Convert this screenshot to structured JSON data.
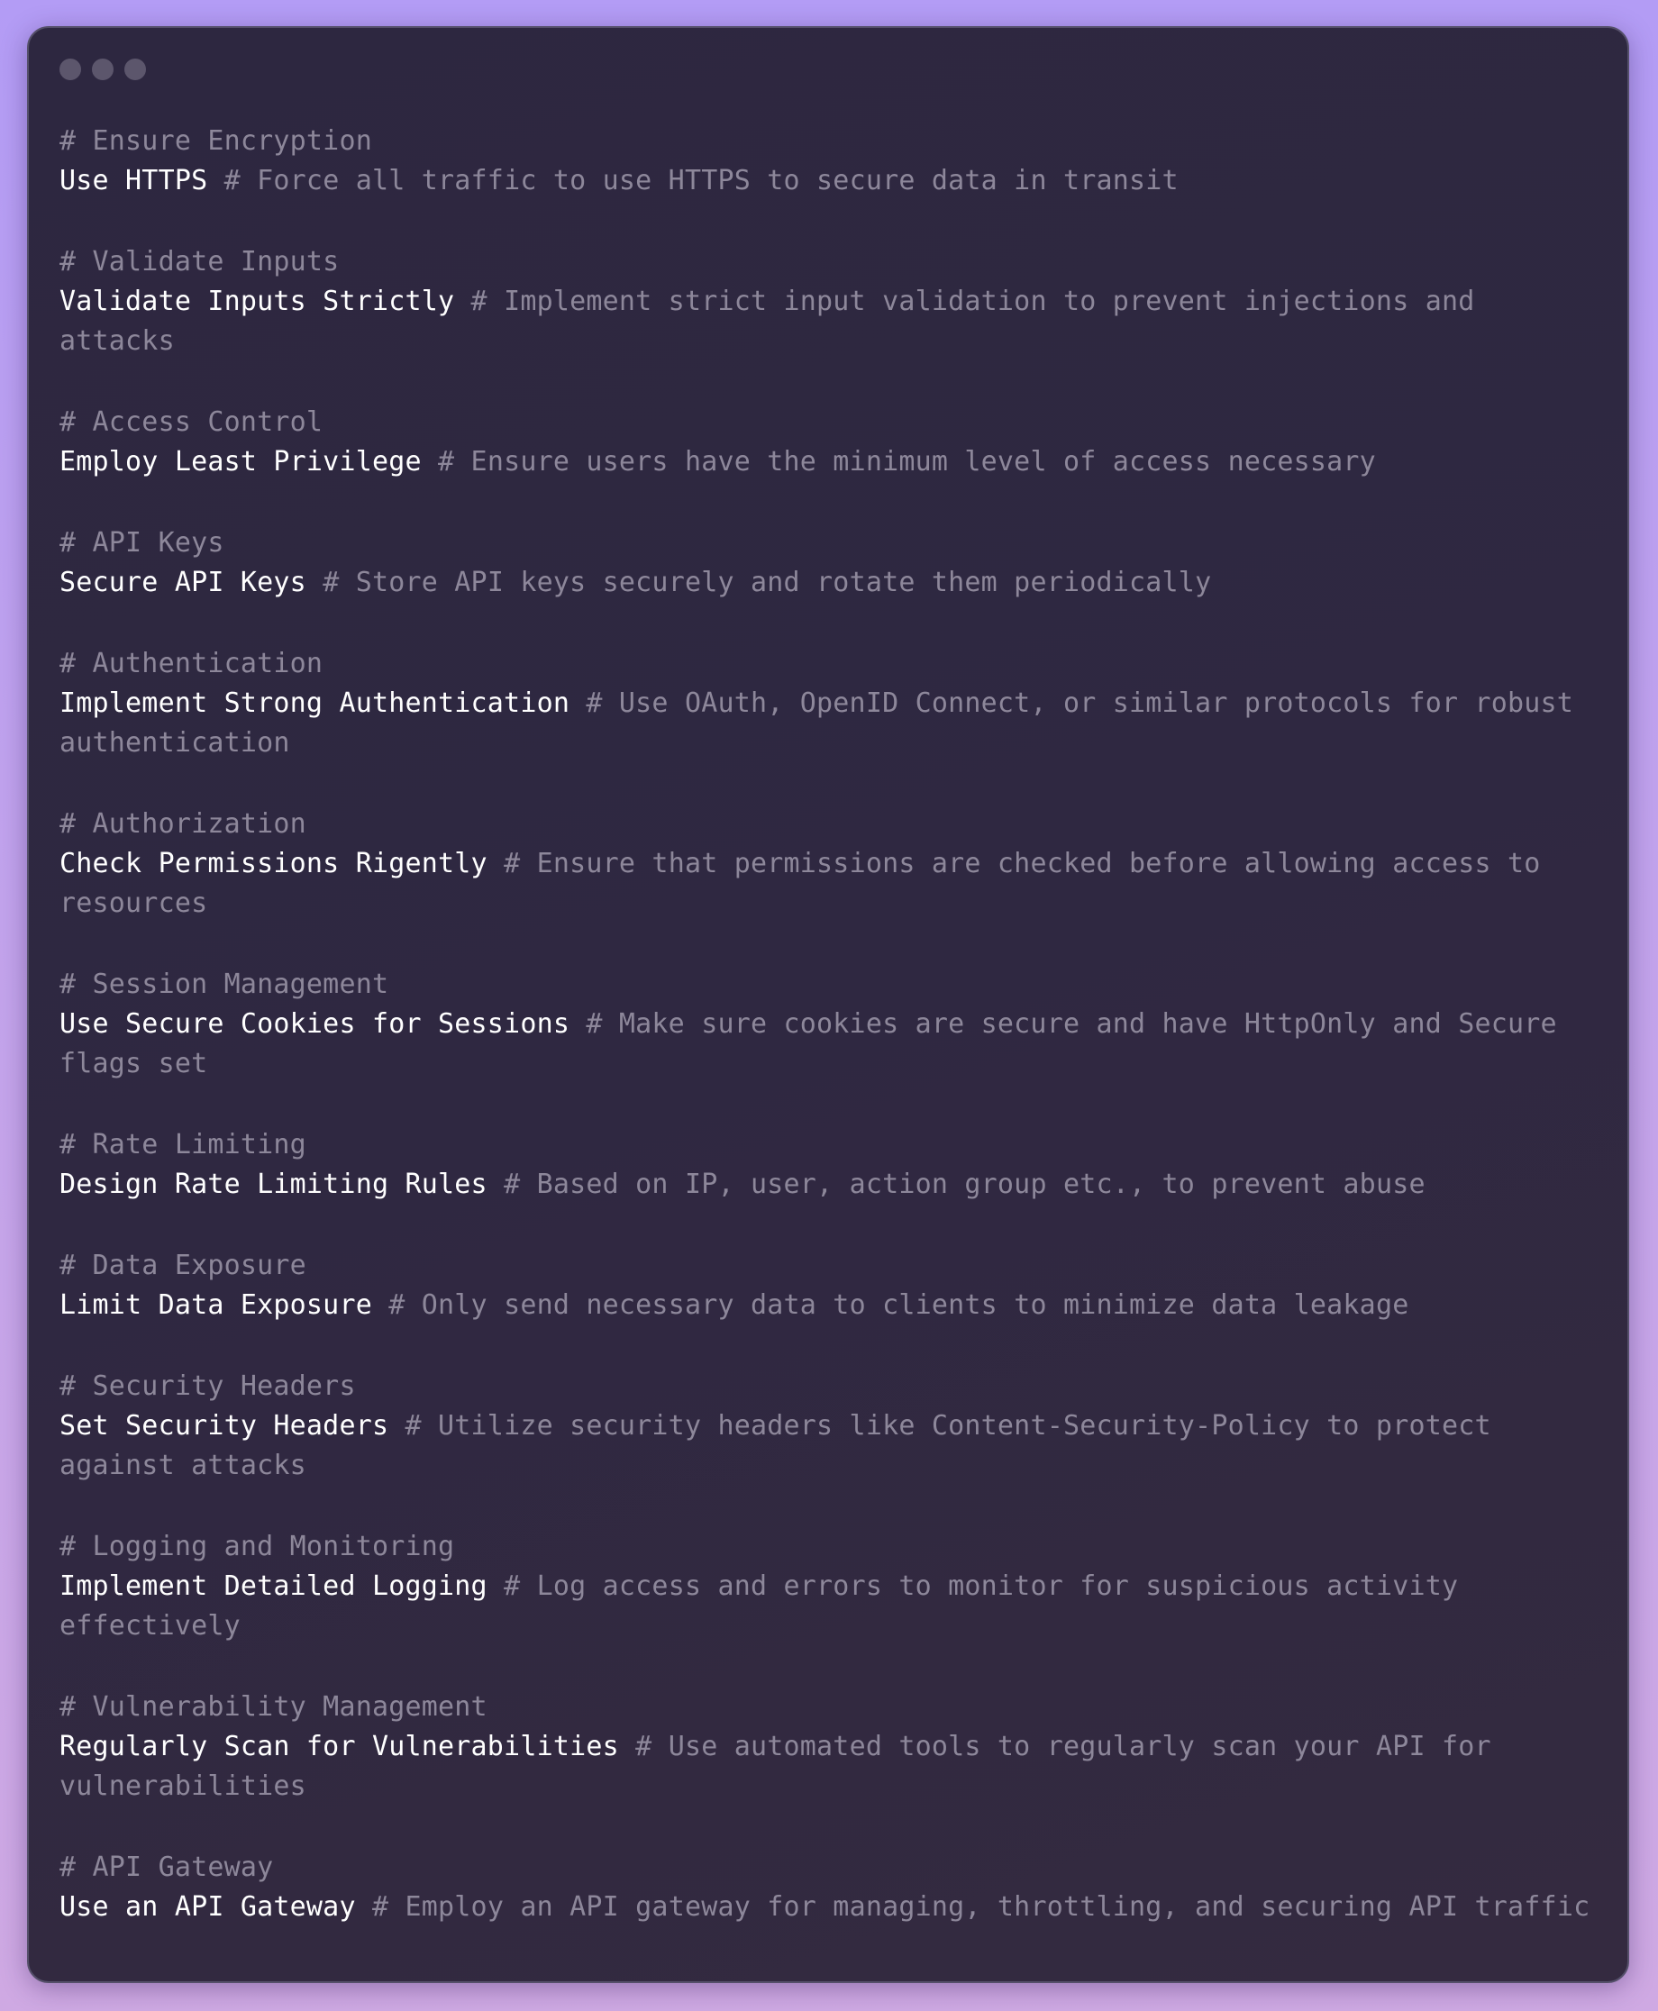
{
  "window": {
    "dot_colors": [
      "#5c566c",
      "#5c566c",
      "#5c566c"
    ]
  },
  "colors": {
    "background_top": "#b39cf5",
    "window_bg": "#2f2841",
    "command_text": "#ffffff",
    "comment_text": "#8d879a"
  },
  "blocks": [
    {
      "heading": "# Ensure Encryption",
      "command": "Use HTTPS",
      "comment": "# Force all traffic to use HTTPS to secure data in transit"
    },
    {
      "heading": "# Validate Inputs",
      "command": "Validate Inputs Strictly",
      "comment": "# Implement strict input validation to prevent injections and attacks"
    },
    {
      "heading": "# Access Control",
      "command": "Employ Least Privilege",
      "comment": "# Ensure users have the minimum level of access necessary"
    },
    {
      "heading": "# API Keys",
      "command": "Secure API Keys",
      "comment": "# Store API keys securely and rotate them periodically"
    },
    {
      "heading": "# Authentication",
      "command": "Implement Strong Authentication",
      "comment": "# Use OAuth, OpenID Connect, or similar protocols for robust authentication"
    },
    {
      "heading": "# Authorization",
      "command": "Check Permissions Rigently",
      "comment": "# Ensure that permissions are checked before allowing access to resources"
    },
    {
      "heading": "# Session Management",
      "command": "Use Secure Cookies for Sessions",
      "comment": "# Make sure cookies are secure and have HttpOnly and Secure flags set"
    },
    {
      "heading": "# Rate Limiting",
      "command": "Design Rate Limiting Rules",
      "comment": "# Based on IP, user, action group etc., to prevent abuse"
    },
    {
      "heading": "# Data Exposure",
      "command": "Limit Data Exposure",
      "comment": "# Only send necessary data to clients to minimize data leakage"
    },
    {
      "heading": "# Security Headers",
      "command": "Set Security Headers",
      "comment": "# Utilize security headers like Content-Security-Policy to protect against attacks"
    },
    {
      "heading": "# Logging and Monitoring",
      "command": "Implement Detailed Logging",
      "comment": "# Log access and errors to monitor for suspicious activity effectively"
    },
    {
      "heading": "# Vulnerability Management",
      "command": "Regularly Scan for Vulnerabilities",
      "comment": "# Use automated tools to regularly scan your API for vulnerabilities"
    },
    {
      "heading": "# API Gateway",
      "command": "Use an API Gateway",
      "comment": "# Employ an API gateway for managing, throttling, and securing API traffic"
    }
  ]
}
